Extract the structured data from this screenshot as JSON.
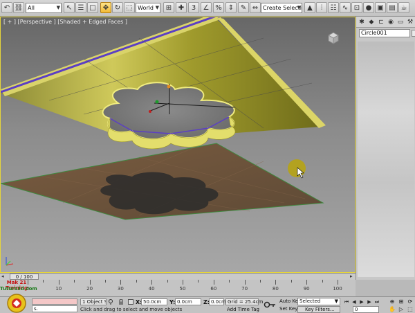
{
  "toolbar": {
    "filter_value": "All",
    "coord_system": "World",
    "named_selection_placeholder": "Create Selection Se"
  },
  "viewport": {
    "label": "[ + ] [Perspective ] [Shaded + Edged Faces ]"
  },
  "command_panel": {
    "object_name": "Circle001"
  },
  "time_slider": {
    "frame_label": "0 / 100",
    "ticks": [
      "0",
      "10",
      "20",
      "30",
      "40",
      "50",
      "60",
      "70",
      "80",
      "90",
      "100"
    ]
  },
  "status": {
    "selection_count": "1 Object Selec",
    "prompt": "Click and drag to select and move objects",
    "x_label": "X:",
    "x_value": "50.0cm",
    "y_label": "Y:",
    "y_value": "0.0cm",
    "z_label": "Z:",
    "z_value": "0.0cm",
    "grid": "Grid = 25.4cm",
    "add_time_tag": "Add Time Tag",
    "auto_key": "Auto Key",
    "set_key": "Set Key",
    "selected_option": "Selected",
    "key_filters": "Key Filters...",
    "current_frame": "0",
    "listener_text": "s."
  },
  "logo": {
    "line1": "Mak 21 Training",
    "line2": "Tuturs3d.com"
  },
  "colors": {
    "accent_yellow": "#e7d63a",
    "ceiling_yellow": "#bdb52a",
    "selection_purple": "#5b3fc4",
    "floor_brown": "#6e5238"
  }
}
